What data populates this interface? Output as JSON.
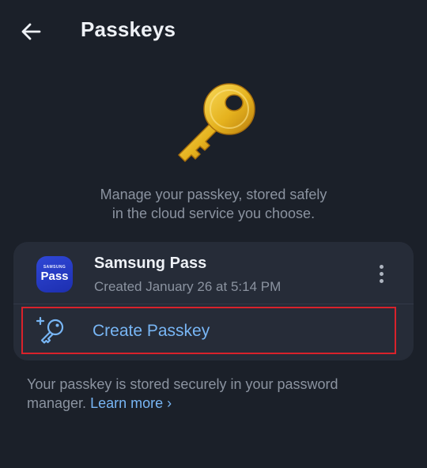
{
  "header": {
    "title": "Passkeys",
    "back_icon": "arrow-left-icon"
  },
  "hero": {
    "icon": "golden-key-icon",
    "description_line1": "Manage your passkey, stored safely",
    "description_line2": "in the cloud service you choose."
  },
  "provider": {
    "icon_brand": "SAMSUNG",
    "icon_word": "Pass",
    "name": "Samsung Pass",
    "created": "Created January 26 at 5:14 PM",
    "menu_icon": "more-vertical-icon"
  },
  "create": {
    "icon": "add-key-icon",
    "label": "Create Passkey"
  },
  "footer": {
    "text": "Your passkey is stored securely in your password manager.",
    "link": "Learn more",
    "link_chevron": "›"
  },
  "colors": {
    "background": "#1b2029",
    "card": "#262c38",
    "accent": "#78b6f5",
    "highlight": "#d9222b",
    "key_gold": "#e5b21e"
  }
}
